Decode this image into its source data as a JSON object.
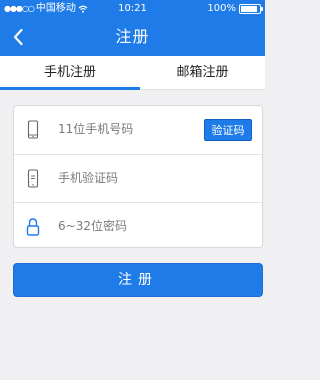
{
  "status_bar": {
    "signal": "●●●○○",
    "carrier": "中国移动",
    "time": "10:21",
    "battery": "100%"
  },
  "nav": {
    "title": "注册",
    "back_icon": "chevron-left-icon"
  },
  "tabs": [
    {
      "label": "手机注册",
      "active": true
    },
    {
      "label": "邮箱注册",
      "active": false
    }
  ],
  "form": {
    "phone": {
      "placeholder": "11位手机号码",
      "value": "",
      "icon": "phone-icon"
    },
    "code_button": "验证码",
    "verify": {
      "placeholder": "手机验证码",
      "value": "",
      "icon": "phone-message-icon"
    },
    "password": {
      "placeholder": "6~32位密码",
      "value": "",
      "icon": "lock-icon"
    }
  },
  "submit_label": "注册",
  "colors": {
    "accent": "#1f7be8",
    "background": "#f0f0f2"
  }
}
